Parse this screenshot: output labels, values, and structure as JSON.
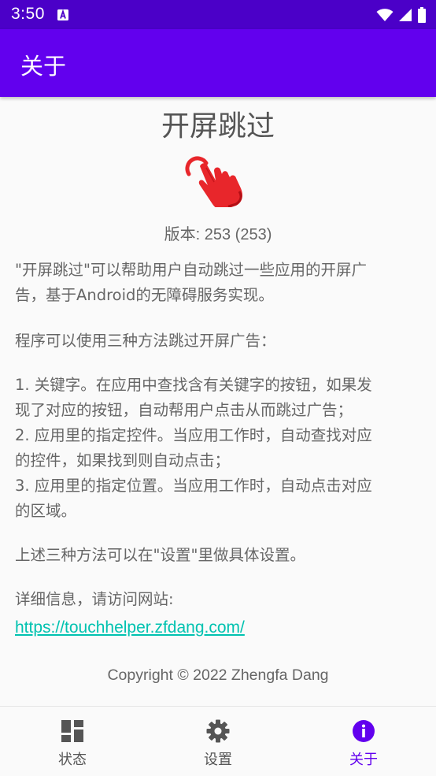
{
  "status_bar": {
    "time": "3:50",
    "notification_icon": "font-a-icon",
    "wifi_icon": "wifi-icon",
    "signal_icon": "signal-icon",
    "battery_icon": "battery-icon"
  },
  "app_bar": {
    "title": "关于",
    "color": "#6200ee"
  },
  "about": {
    "app_name": "开屏跳过",
    "logo_icon": "tap-hand-icon",
    "version": "版本: 253 (253)",
    "intro_lines": [
      "\"开屏跳过\"可以帮助用户自动跳过一些应用的开屏广",
      "告，基于Android的无障碍服务实现。"
    ],
    "methods_title": "程序可以使用三种方法跳过开屏广告：",
    "methods_lines": [
      "1. 关键字。在应用中查找含有关键字的按钮，如果发",
      "现了对应的按钮，自动帮用户点击从而跳过广告；",
      "2. 应用里的指定控件。当应用工作时，自动查找对应",
      "的控件，如果找到则自动点击；",
      "3. 应用里的指定位置。当应用工作时，自动点击对应",
      "的区域。"
    ],
    "settings_note": "上述三种方法可以在\"设置\"里做具体设置。",
    "details_label": "详细信息，请访问网站:",
    "website_url": "https://touchhelper.zfdang.com/",
    "copyright": "Copyright © 2022 Zhengfa Dang",
    "link_color": "#00c2b0"
  },
  "bottom_nav": {
    "items": [
      {
        "label": "状态",
        "icon": "dashboard-icon",
        "active": false
      },
      {
        "label": "设置",
        "icon": "gear-icon",
        "active": false
      },
      {
        "label": "关于",
        "icon": "info-icon",
        "active": true
      }
    ],
    "active_color": "#6200ee"
  }
}
